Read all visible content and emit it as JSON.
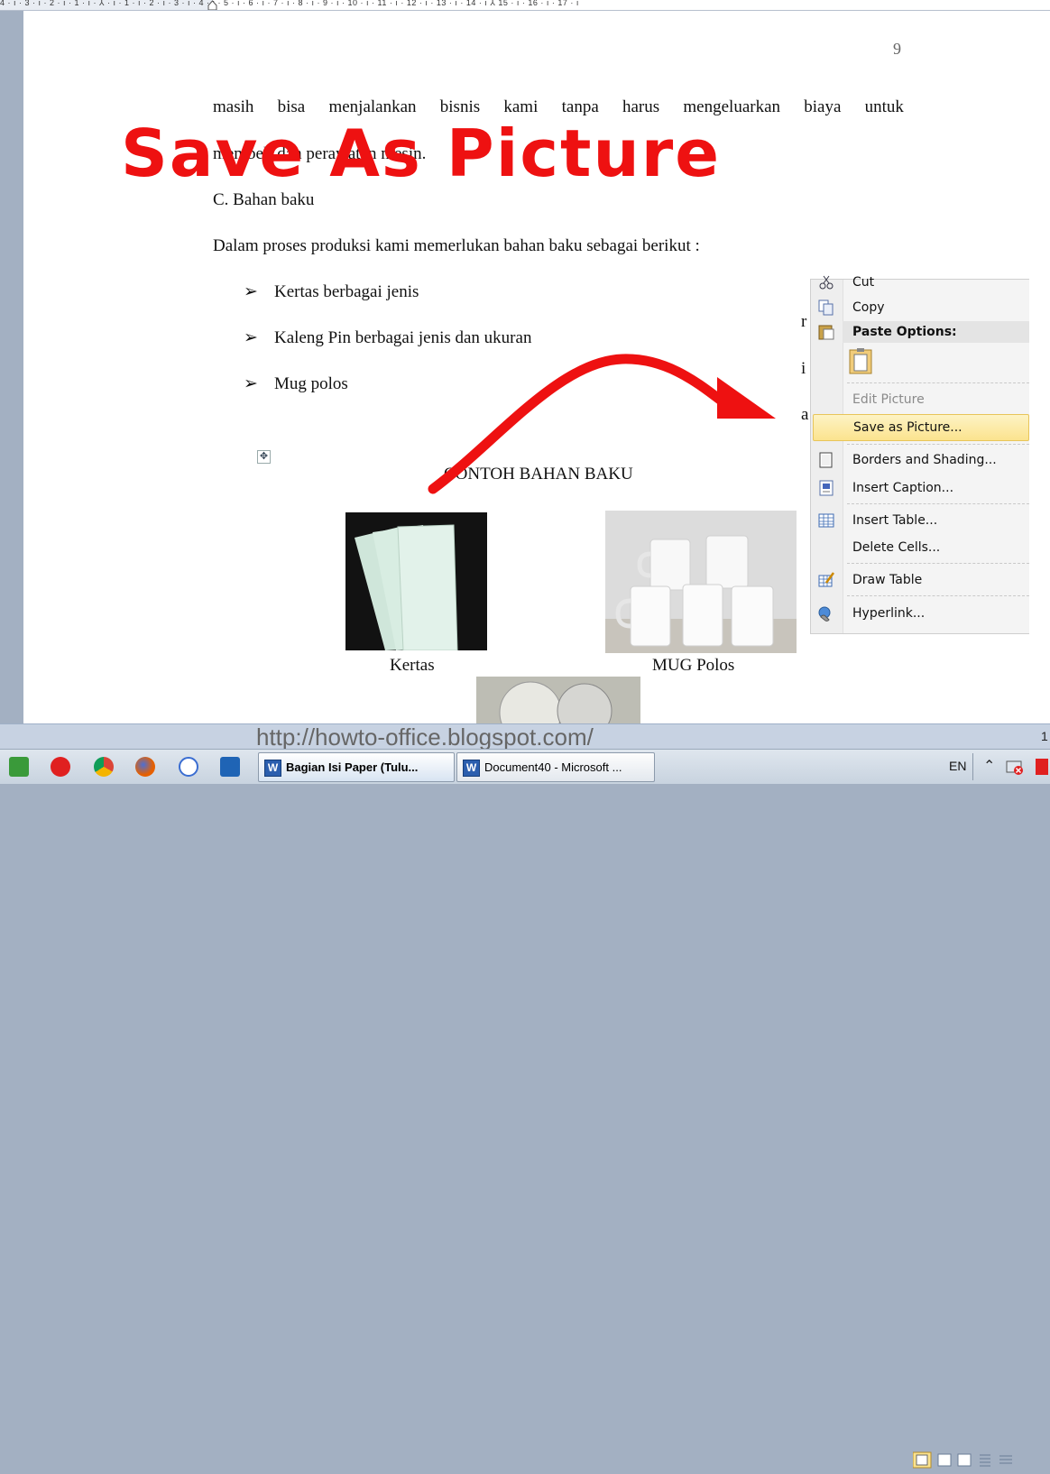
{
  "ruler": {
    "numbers": "4 · ı · 3 · ı · 2 · ı · 1 · ı · ⅄ · ı · 1 · ı · 2 · ı · 3 · ı · 4 · ı · 5 · ı · 6 · ı · 7 · ı · 8 · ı · 9 · ı · 10 · ı · 11 · ı · 12 · ı · 13 · ı · 14 · ı ⅄ 15 · ı · 16 · ı · 17 · ı"
  },
  "document": {
    "page_number": "9",
    "para1_words": [
      "masih",
      "bisa",
      "menjalankan",
      "bisnis",
      "kami",
      "tanpa",
      "harus",
      "mengeluarkan",
      "biaya",
      "untuk"
    ],
    "para1_line2": "membeli dan perawatan mesin.",
    "section_heading": "C. Bahan baku",
    "intro": "Dalam proses produksi kami memerlukan bahan baku sebagai berikut :",
    "bullets": [
      {
        "marker": "➢",
        "text": "Kertas berbagai jenis"
      },
      {
        "marker": "➢",
        "text": "Kaleng Pin berbagai jenis dan ukuran"
      },
      {
        "marker": "➢",
        "text": "Mug polos"
      }
    ],
    "table_move_handle": "✥",
    "table_title": "CONTOH BAHAN BAKU",
    "caption_left": "Kertas",
    "caption_right": "MUG Polos",
    "cut_off_chars": [
      "r",
      "i",
      "a"
    ]
  },
  "banner": {
    "text": "Save As Picture",
    "color": "#ee1111"
  },
  "context_menu": {
    "items": [
      {
        "label": "Cut",
        "icon": "scissors-icon"
      },
      {
        "label": "Copy",
        "icon": "copy-icon"
      },
      {
        "label": "Paste Options:",
        "icon": "paste-icon"
      },
      {
        "label": "Edit Picture",
        "disabled": true
      },
      {
        "label": "Save as Picture...",
        "highlighted": true
      },
      {
        "label": "Borders and Shading...",
        "icon": "borders-icon"
      },
      {
        "label": "Insert Caption...",
        "icon": "caption-icon"
      },
      {
        "label": "Insert Table...",
        "icon": "table-icon"
      },
      {
        "label": "Delete Cells..."
      },
      {
        "label": "Draw Table",
        "icon": "draw-table-icon"
      },
      {
        "label": "Hyperlink...",
        "icon": "hyperlink-icon"
      }
    ],
    "highlight_color": "#fbe38e"
  },
  "watermark_url": "http://howto-office.blogspot.com/",
  "statusbar": {
    "zoom_fragment": "1"
  },
  "taskbar": {
    "buttons": [
      {
        "label": "Bagian Isi Paper (Tulu...",
        "active": true
      },
      {
        "label": "Document40 - Microsoft ...",
        "active": false
      }
    ],
    "tray": {
      "language": "EN",
      "expand": "⌃"
    }
  }
}
